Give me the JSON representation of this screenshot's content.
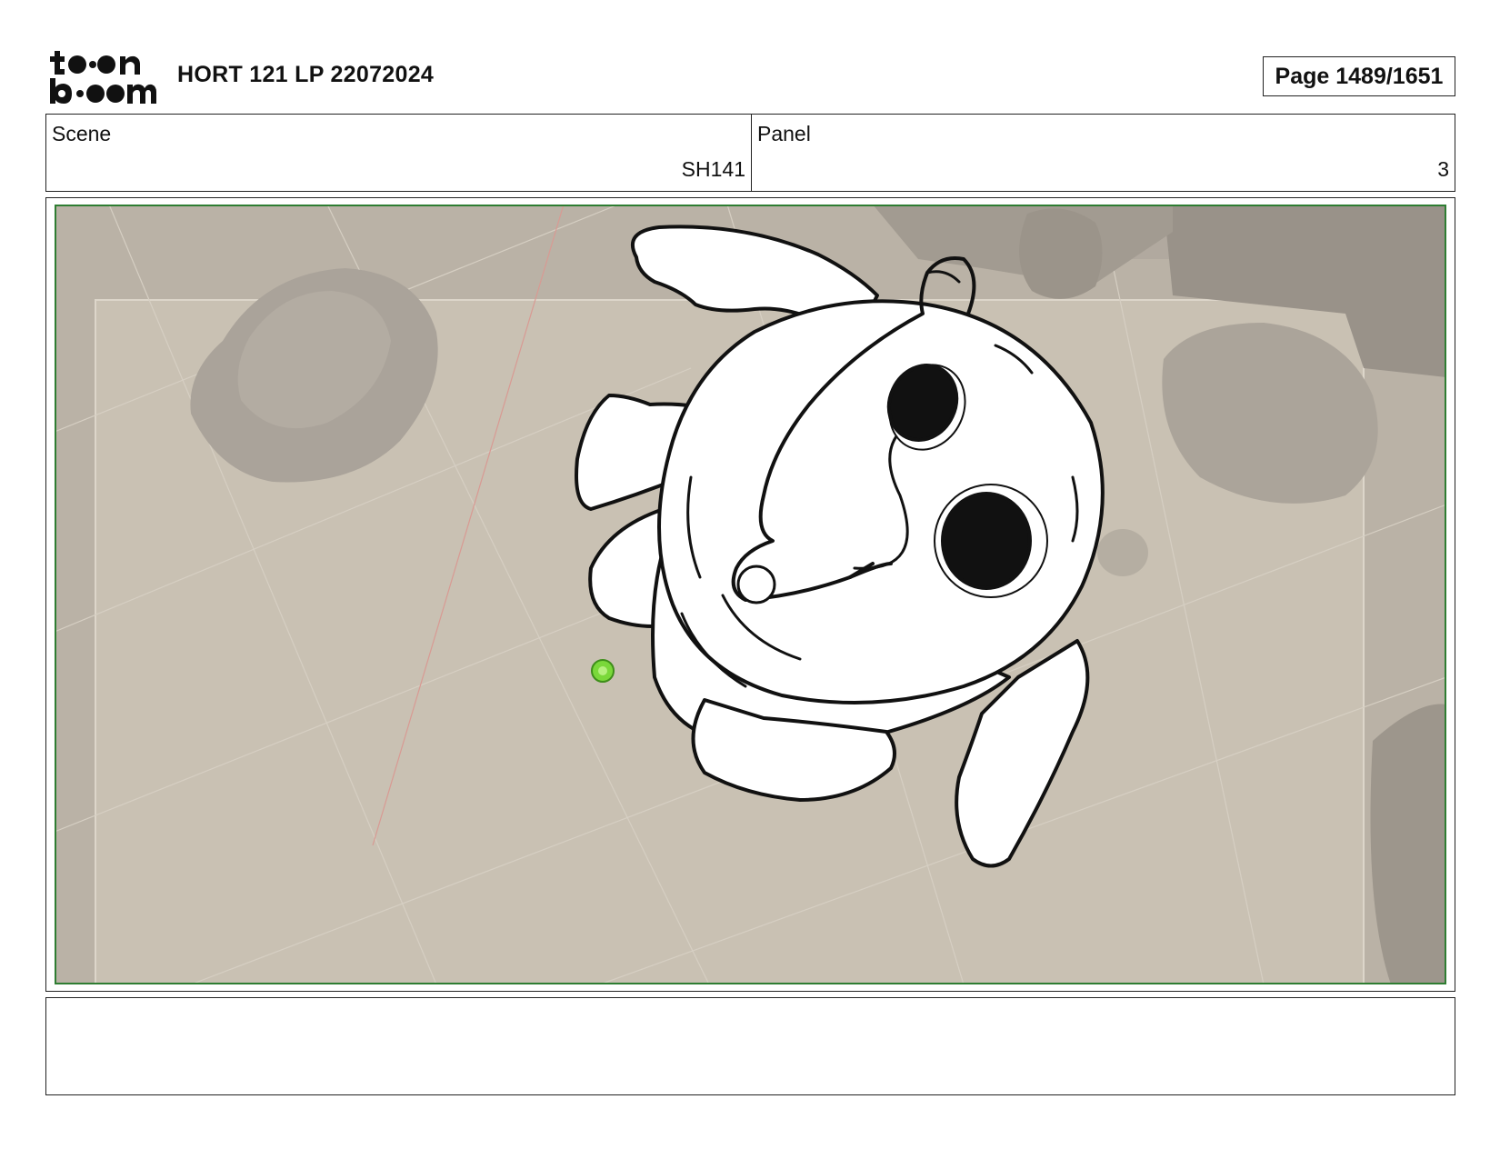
{
  "header": {
    "logo_text": "toon boom",
    "title": "HORT 121 LP 22072024",
    "page_label": "Page 1489/1651"
  },
  "info": {
    "scene_label": "Scene",
    "scene_value": "SH141",
    "panel_label": "Panel",
    "panel_value": "3"
  },
  "notes": {
    "text": ""
  },
  "colors": {
    "frame_border": "#2e7d32",
    "background_floor": "#cbc3b5",
    "rock_gray": "#aca59b",
    "ink": "#111111",
    "marker_green": "#7ad83a"
  },
  "icons": {
    "logo": "toon-boom-logo",
    "marker": "green-position-marker-icon"
  }
}
